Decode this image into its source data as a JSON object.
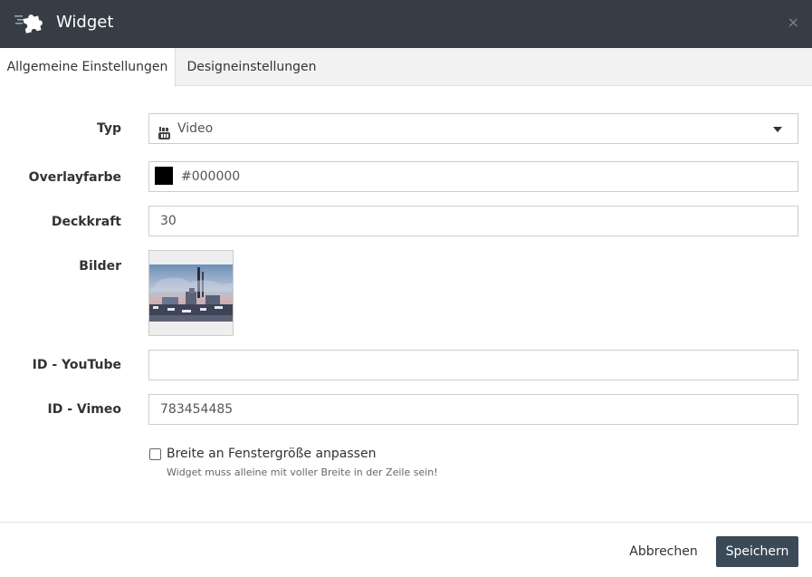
{
  "dialog": {
    "title": "Widget",
    "close_label": "×",
    "header_icon": "puzzle-piece-icon"
  },
  "tabs": [
    {
      "label": "Allgemeine Einstellungen",
      "active": true
    },
    {
      "label": "Designeinstellungen",
      "active": false
    }
  ],
  "form": {
    "typ": {
      "label": "Typ",
      "value": "Video",
      "icon": "youtube-icon"
    },
    "overlay": {
      "label": "Overlayfarbe",
      "value": "#000000",
      "swatch_color": "#000000"
    },
    "opacity": {
      "label": "Deckkraft",
      "value": "30"
    },
    "images": {
      "label": "Bilder"
    },
    "youtube": {
      "label": "ID - YouTube",
      "value": ""
    },
    "vimeo": {
      "label": "ID - Vimeo",
      "value": "783454485"
    },
    "fullwidth": {
      "label": "Breite an Fenstergröße anpassen",
      "checked": false,
      "help": "Widget muss alleine mit voller Breite in der Zeile sein!"
    }
  },
  "footer": {
    "cancel_label": "Abbrechen",
    "save_label": "Speichern"
  },
  "colors": {
    "header_bg": "#363d45",
    "primary_button": "#3a4a57",
    "tab_bar_bg": "#f2f2f2"
  }
}
